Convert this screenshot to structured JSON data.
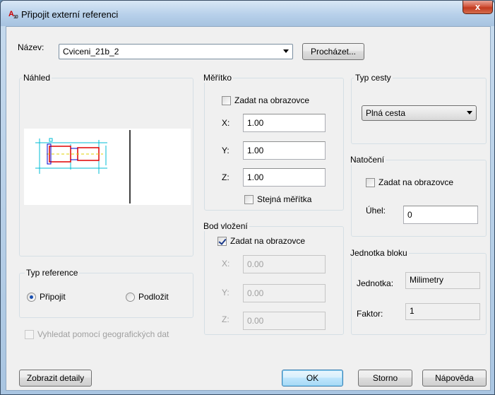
{
  "window": {
    "title": "Připojit externí referenci",
    "app_icon": "autocad-icon",
    "close_glyph": "x"
  },
  "name_row": {
    "label": "Název:",
    "value": "Cviceni_21b_2",
    "browse_label": "Procházet..."
  },
  "preview": {
    "label": "Náhled"
  },
  "scale": {
    "title": "Měřítko",
    "specify_on_screen": "Zadat na obrazovce",
    "specify_checked": false,
    "x_label": "X:",
    "x_value": "1.00",
    "y_label": "Y:",
    "y_value": "1.00",
    "z_label": "Z:",
    "z_value": "1.00",
    "uniform_label": "Stejná měřítka",
    "uniform_checked": false
  },
  "insertion": {
    "title": "Bod vložení",
    "specify_on_screen": "Zadat na obrazovce",
    "specify_checked": true,
    "x_label": "X:",
    "x_value": "0.00",
    "y_label": "Y:",
    "y_value": "0.00",
    "z_label": "Z:",
    "z_value": "0.00"
  },
  "path_type": {
    "title": "Typ cesty",
    "selected": "Plná cesta"
  },
  "rotation": {
    "title": "Natočení",
    "specify_on_screen": "Zadat na obrazovce",
    "specify_checked": false,
    "angle_label": "Úhel:",
    "angle_value": "0"
  },
  "block_unit": {
    "title": "Jednotka bloku",
    "unit_label": "Jednotka:",
    "unit_value": "Milimetry",
    "factor_label": "Faktor:",
    "factor_value": "1"
  },
  "ref_type": {
    "title": "Typ reference",
    "attach_label": "Připojit",
    "overlay_label": "Podložit",
    "selected": "attach"
  },
  "geo_checkbox": {
    "label": "Vyhledat pomocí geografických dat"
  },
  "buttons": {
    "details": "Zobrazit detaily",
    "ok": "OK",
    "cancel": "Storno",
    "help": "Nápověda"
  }
}
